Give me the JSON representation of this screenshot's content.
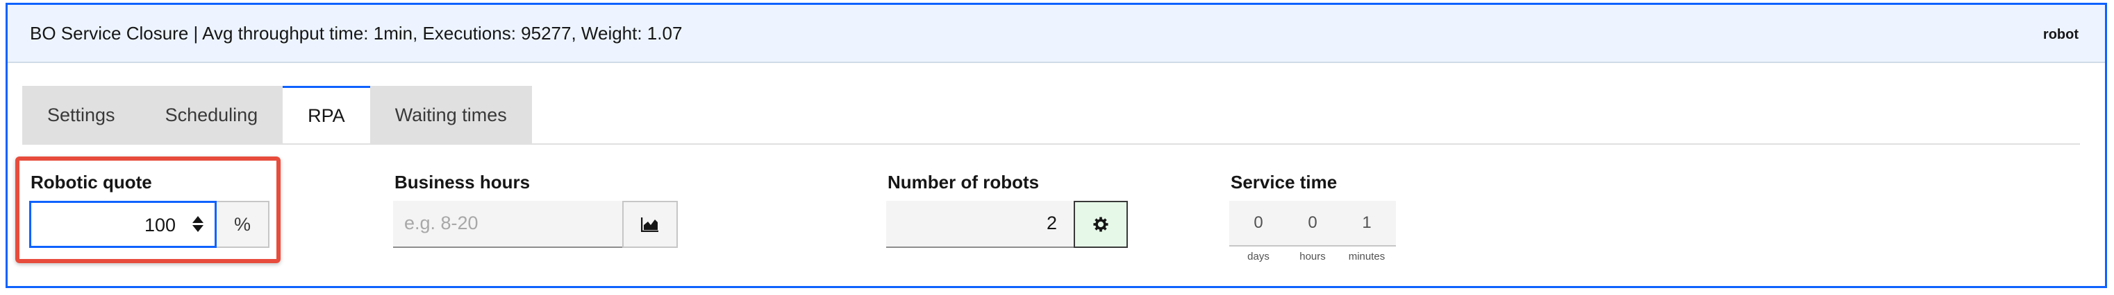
{
  "header": {
    "title": "BO Service Closure | Avg throughput time: 1min, Executions: 95277, Weight: 1.07",
    "tag": "robot"
  },
  "tabs": [
    {
      "label": "Settings",
      "active": false
    },
    {
      "label": "Scheduling",
      "active": false
    },
    {
      "label": "RPA",
      "active": true
    },
    {
      "label": "Waiting times",
      "active": false
    }
  ],
  "robotic_quote": {
    "label": "Robotic quote",
    "value": "100",
    "unit": "%"
  },
  "business_hours": {
    "label": "Business hours",
    "placeholder": "e.g. 8-20",
    "value": ""
  },
  "number_of_robots": {
    "label": "Number of robots",
    "value": "2"
  },
  "service_time": {
    "label": "Service time",
    "values": {
      "days": "0",
      "hours": "0",
      "minutes": "1"
    },
    "units": {
      "days": "days",
      "hours": "hours",
      "minutes": "minutes"
    }
  },
  "colors": {
    "accent": "#0f62fe",
    "highlight": "#e74c3c",
    "header_bg": "#edf4ff",
    "gear_bg": "#e6f9e8"
  },
  "icons": {
    "business_hours_button": "chart-icon",
    "robots_button": "gear-icon"
  }
}
